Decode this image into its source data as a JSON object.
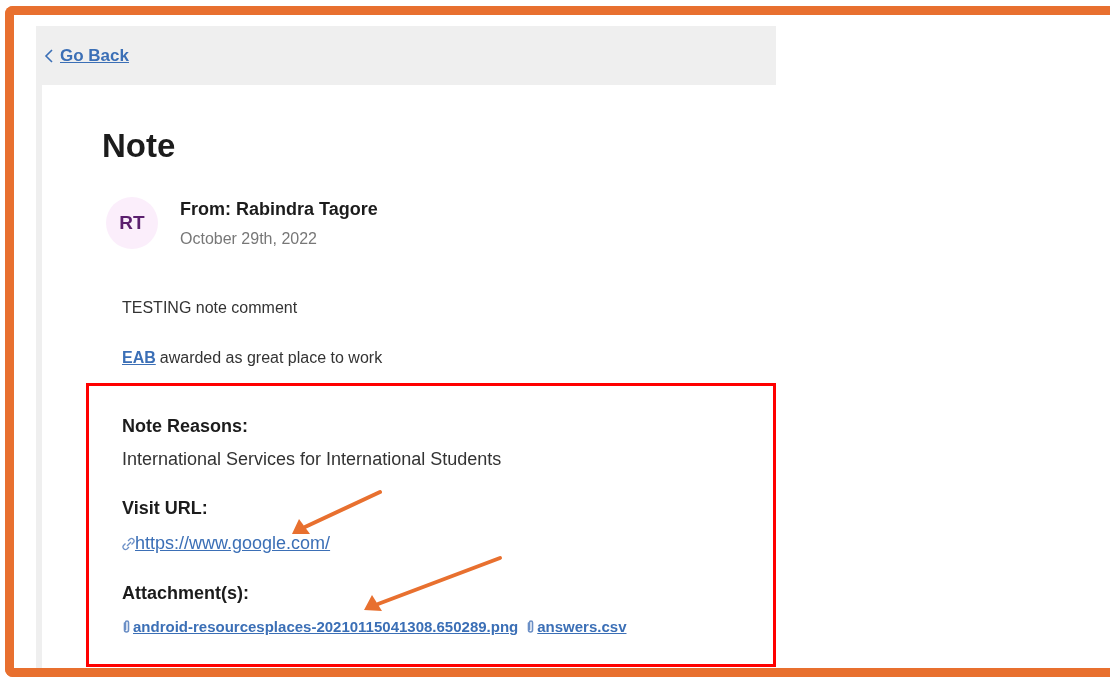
{
  "back_link": {
    "label": "Go Back"
  },
  "note": {
    "title": "Note",
    "author": {
      "initials": "RT",
      "from": "From: Rabindra Tagore",
      "date": "October 29th, 2022"
    },
    "body": [
      {
        "text": "TESTING note comment"
      },
      {
        "link": "EAB",
        "text": "awarded as great place to work"
      }
    ],
    "sections": [
      {
        "kind": "text",
        "label": "Note Reasons:",
        "value": "International Services for International Students"
      },
      {
        "kind": "url",
        "label": "Visit URL:",
        "url": "https://www.google.com/"
      },
      {
        "kind": "files",
        "label": "Attachment(s):",
        "files": [
          "android-resourcesplaces-20210115041308.650289.png",
          "answers.csv"
        ]
      }
    ]
  }
}
